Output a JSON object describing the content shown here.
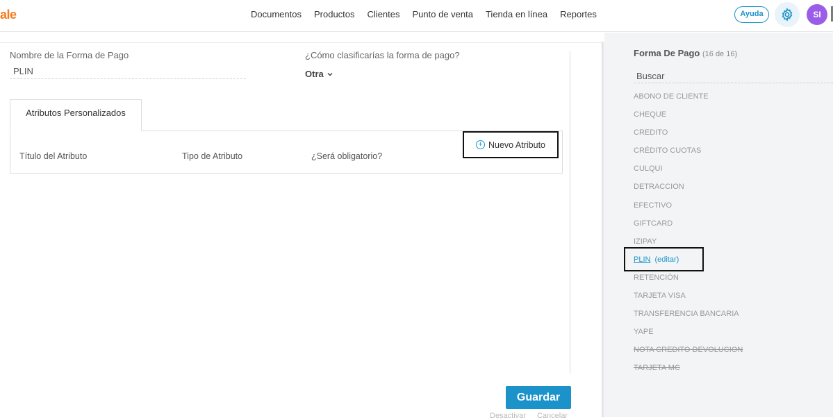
{
  "header": {
    "logo": "ale",
    "nav": [
      "Documentos",
      "Productos",
      "Clientes",
      "Punto de venta",
      "Tienda en línea",
      "Reportes"
    ],
    "help_label": "Ayuda",
    "avatar_initials": "SI"
  },
  "form": {
    "name_label": "Nombre de la Forma de Pago",
    "name_value": "PLIN",
    "class_label": "¿Cómo clasificarías la forma de pago?",
    "class_value": "Otra",
    "tab_label": "Atributos Personalizados",
    "columns": [
      "Título del Atributo",
      "Tipo de Atributo",
      "¿Será obligatorio?"
    ],
    "new_attr_label": "Nuevo Atributo",
    "save_label": "Guardar",
    "deactivate_label": "Desactivar",
    "cancel_label": "Cancelar"
  },
  "sidebar": {
    "title": "Forma De Pago",
    "count": "(16 de 16)",
    "search_placeholder": "Buscar",
    "items": [
      {
        "label": "ABONO DE CLIENTE"
      },
      {
        "label": "CHEQUE"
      },
      {
        "label": "CREDITO"
      },
      {
        "label": "CRÉDITO CUOTAS"
      },
      {
        "label": "CULQUI"
      },
      {
        "label": "DETRACCION"
      },
      {
        "label": "EFECTIVO"
      },
      {
        "label": "GIFTCARD"
      },
      {
        "label": "IZIPAY"
      },
      {
        "label": "PLIN",
        "edit": "(editar)"
      },
      {
        "label": "RETENCIÓN"
      },
      {
        "label": "TARJETA VISA"
      },
      {
        "label": "TRANSFERENCIA BANCARIA"
      },
      {
        "label": "YAPE"
      },
      {
        "label": "NOTA CREDITO DEVOLUCION"
      },
      {
        "label": "TARJETA MC"
      }
    ]
  },
  "colors": {
    "brand": "#f47c20",
    "accent": "#1b92c9",
    "avatar": "#9a5de8"
  }
}
